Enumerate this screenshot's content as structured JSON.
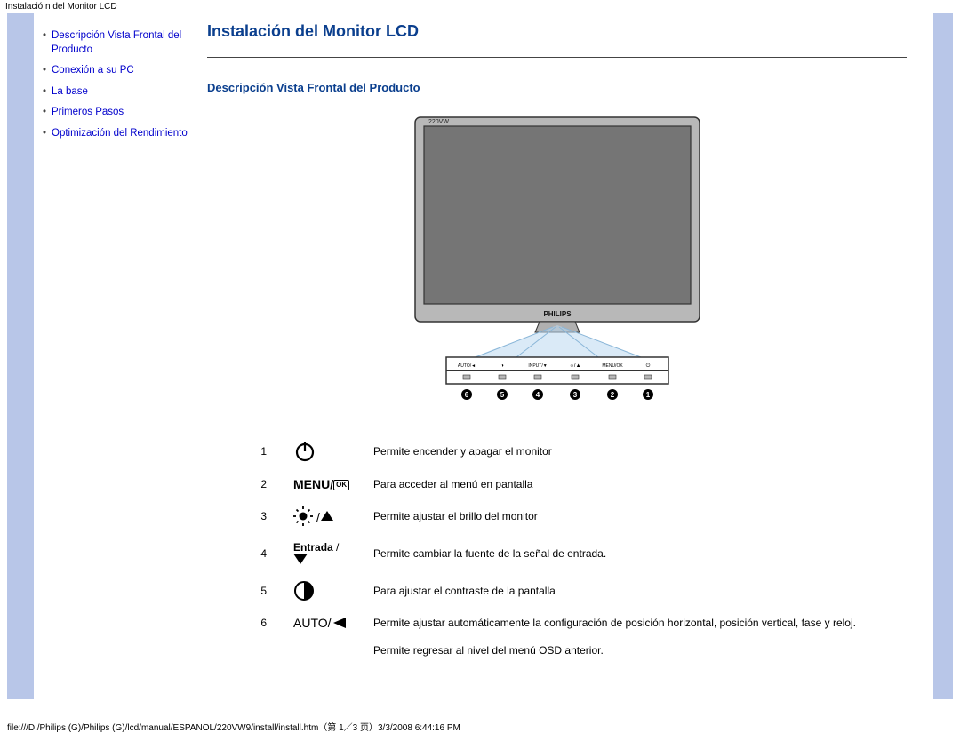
{
  "header_strip": "Instalació n del Monitor LCD",
  "sidebar": {
    "items": [
      {
        "label": "Descripción Vista Frontal del Producto"
      },
      {
        "label": "Conexión a su PC"
      },
      {
        "label": "La base"
      },
      {
        "label": "Primeros Pasos"
      },
      {
        "label": "Optimización del Rendimiento"
      }
    ]
  },
  "main": {
    "title": "Instalación del Monitor LCD",
    "section_title": "Descripción Vista Frontal del Producto",
    "monitor_model": "220VW",
    "monitor_brand": "PHILIPS",
    "panel_labels": [
      "AUTO/◄",
      "◑",
      "INPUT/▼",
      "☼/▲",
      "MENU/OK",
      "⏻"
    ],
    "panel_numbers": [
      "6",
      "5",
      "4",
      "3",
      "2",
      "1"
    ],
    "buttons": [
      {
        "num": "1",
        "desc": "Permite encender y apagar el monitor"
      },
      {
        "num": "2",
        "desc": "Para acceder al menú en pantalla"
      },
      {
        "num": "3",
        "desc": "Permite ajustar el brillo del monitor"
      },
      {
        "num": "4",
        "entrada": "Entrada",
        "desc": "Permite cambiar la fuente de la señal de entrada."
      },
      {
        "num": "5",
        "desc": "Para ajustar el contraste de la pantalla"
      },
      {
        "num": "6",
        "desc": "Permite ajustar automáticamente la configuración de posición horizontal, posición vertical, fase y reloj."
      }
    ],
    "extra_line": "Permite regresar al nivel del menú OSD anterior.",
    "menu_label": "MENU",
    "ok_label": "OK",
    "auto_label": "AUTO"
  },
  "footer": "file:///D|/Philips (G)/Philips (G)/lcd/manual/ESPANOL/220VW9/install/install.htm（第 1／3 页）3/3/2008 6:44:16 PM"
}
